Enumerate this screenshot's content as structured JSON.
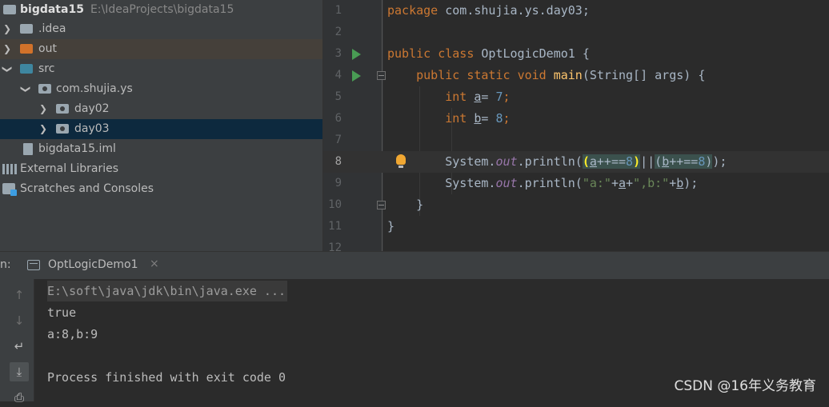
{
  "project_tree": {
    "root": {
      "name": "bigdata15",
      "path": "E:\\IdeaProjects\\bigdata15"
    },
    "items": [
      {
        "label": ".idea"
      },
      {
        "label": "out"
      },
      {
        "label": "src"
      },
      {
        "label": "com.shujia.ys"
      },
      {
        "label": "day02"
      },
      {
        "label": "day03"
      },
      {
        "label": "bigdata15.iml"
      },
      {
        "label": "External Libraries"
      },
      {
        "label": "Scratches and Consoles"
      }
    ]
  },
  "editor": {
    "line_numbers": [
      "1",
      "2",
      "3",
      "4",
      "5",
      "6",
      "7",
      "8",
      "9",
      "10",
      "11",
      "12"
    ],
    "code": {
      "l1_kw": "package",
      "l1_rest": " com.shujia.ys.day03;",
      "l3_kw1": "public",
      "l3_kw2": "class",
      "l3_name": "OptLogicDemo1",
      "l3_brace": " {",
      "l4_kw1": "public",
      "l4_kw2": "static",
      "l4_kw3": "void",
      "l4_fn": "main",
      "l4_rest": "(String[] args) {",
      "l5_kw": "int",
      "l5_var": "a",
      "l5_eq": "= ",
      "l5_num": "7",
      "l5_semi": ";",
      "l6_kw": "int",
      "l6_var": "b",
      "l6_eq": "= ",
      "l6_num": "8",
      "l6_semi": ";",
      "l8_sys": "System.",
      "l8_out": "out",
      "l8_println": ".println(",
      "l8_open": "(",
      "l8_a": "a",
      "l8_aop": "++==",
      "l8_num1": "8",
      "l8_close": ")",
      "l8_or": "||",
      "l8_open2": "(",
      "l8_b": "b",
      "l8_bop": "++==",
      "l8_num2": "8",
      "l8_close2": ")",
      "l8_end": ");",
      "l9_sys": "System.",
      "l9_out": "out",
      "l9_println": ".println(",
      "l9_str1": "\"a:\"",
      "l9_plus1": "+",
      "l9_a": "a",
      "l9_plus2": "+",
      "l9_str2": "\",b:\"",
      "l9_plus3": "+",
      "l9_b": "b",
      "l9_end": ");",
      "l10": "}",
      "l11": "}"
    }
  },
  "run_panel": {
    "label": "n:",
    "tab_title": "OptLogicDemo1",
    "tab_close": "×",
    "console_lines": [
      "E:\\soft\\java\\jdk\\bin\\java.exe ...",
      "true",
      "a:8,b:9",
      "",
      "Process finished with exit code 0"
    ],
    "toolbar_icons": [
      "arrow-up-icon",
      "arrow-down-icon",
      "soft-wrap-icon",
      "scroll-to-end-icon",
      "print-icon"
    ]
  },
  "watermark": "CSDN @16年义务教育",
  "colors": {
    "keyword": "#cc7832",
    "number": "#6897bb",
    "field": "#9876aa",
    "string": "#6a8759",
    "method": "#ffc66d",
    "run_icon": "#499c54",
    "selection": "#0d293e"
  }
}
